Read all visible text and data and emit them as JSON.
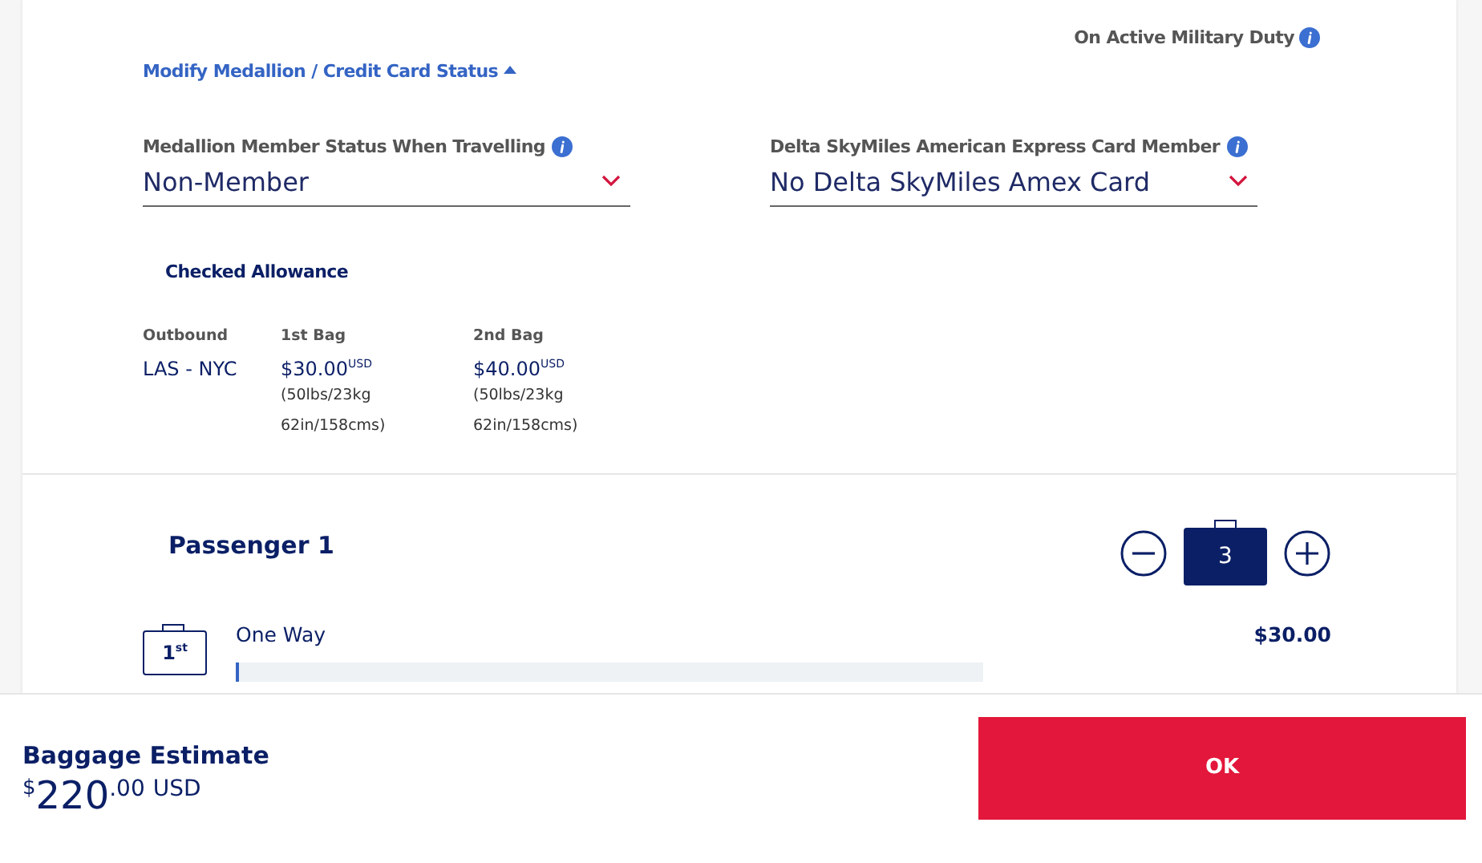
{
  "military_duty": {
    "label": "On Active Military Duty"
  },
  "modify_link": {
    "label": "Modify Medallion / Credit Card Status",
    "expanded": true
  },
  "selects": [
    {
      "label": "Medallion Member Status When Travelling",
      "value": "Non-Member"
    },
    {
      "label": "Delta SkyMiles American Express Card Member",
      "value": "No Delta SkyMiles Amex Card"
    }
  ],
  "allowance": {
    "title": "Checked Allowance",
    "columns": [
      "Outbound",
      "1st Bag",
      "2nd Bag"
    ],
    "route": "LAS - NYC",
    "bags": [
      {
        "price": "$30.00$^{USD}$",
        "weight": "(50lbs/23kg",
        "size": "62in/158cms)"
      },
      {
        "price": "$40.00$^{USD}$",
        "weight": "(50lbs/23kg",
        "size": "62in/158cms)"
      }
    ]
  },
  "passenger": {
    "name": "Passenger 1",
    "bag_count": "3",
    "bags": [
      {
        "badge": "1$^{st}$",
        "label": "One Way",
        "price": "$30.00",
        "level": 0.005
      }
    ]
  },
  "footer": {
    "title": "Baggage Estimate",
    "currency": "$",
    "amount": "220",
    "cents": ".00",
    "unit": "USD",
    "button": "OK"
  }
}
